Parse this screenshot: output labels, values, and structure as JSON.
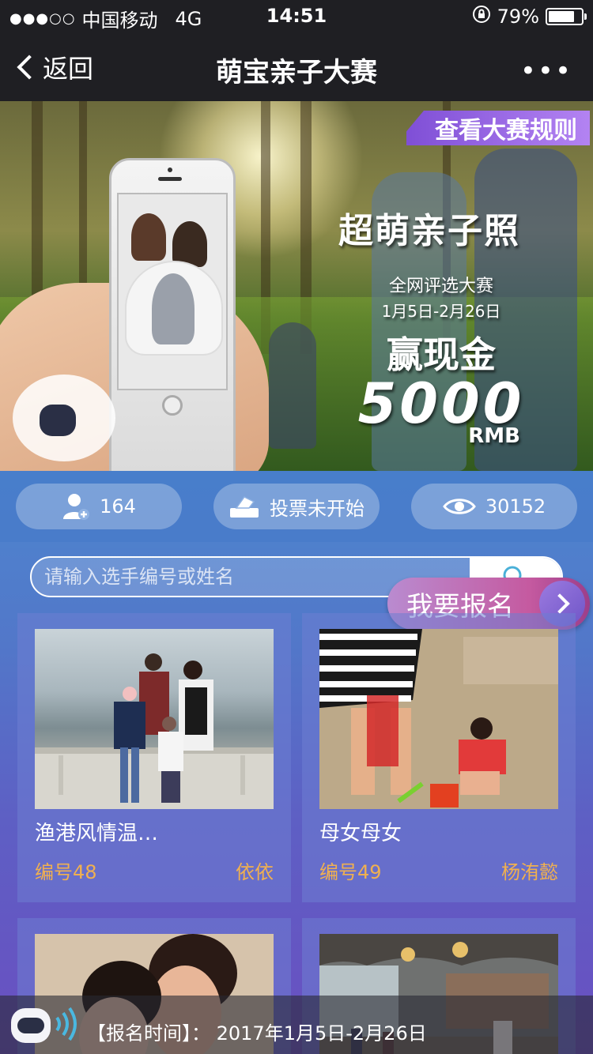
{
  "status_bar": {
    "carrier": "中国移动",
    "network": "4G",
    "time": "14:51",
    "battery": "79%",
    "battery_level": 0.79
  },
  "nav": {
    "back_label": "返回",
    "title": "萌宝亲子大赛",
    "more_label": "•••"
  },
  "banner": {
    "rules_button": "查看大赛规则",
    "headline": "超萌亲子照",
    "subtitle": "全网评选大赛",
    "dates": "1月5日-2月26日",
    "prize_label": "赢现金",
    "prize_amount": "5000",
    "prize_unit": "RMB"
  },
  "stats": {
    "participants": "164",
    "vote_status": "投票未开始",
    "views": "30152"
  },
  "search": {
    "placeholder": "请输入选手编号或姓名"
  },
  "signup_button": "我要报名",
  "entries": [
    {
      "title": "渔港风情温…",
      "number": "编号48",
      "author": "依依"
    },
    {
      "title": "母女母女",
      "number": "编号49",
      "author": "杨洧懿"
    },
    {
      "title": "",
      "number": "",
      "author": ""
    },
    {
      "title": "",
      "number": "",
      "author": ""
    }
  ],
  "ticker": {
    "text": "【报名时间】： 2017年1月5日-2月26日"
  },
  "colors": {
    "accent_orange": "#f0b050",
    "rules_purple": "#8e5fe0",
    "content_blue": "#4d86cf"
  }
}
